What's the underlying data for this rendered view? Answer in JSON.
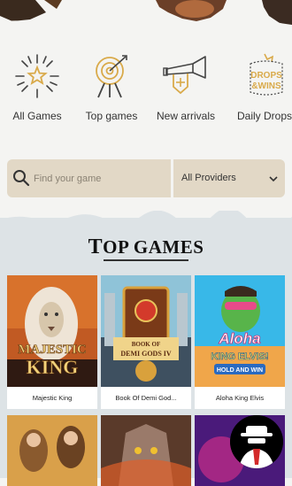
{
  "categories": [
    {
      "label": "All Games",
      "icon": "star-burst-icon"
    },
    {
      "label": "Top games",
      "icon": "archery-target-icon"
    },
    {
      "label": "New arrivals",
      "icon": "trumpet-icon"
    },
    {
      "label": "Daily Drops &",
      "icon": "drops-wins-badge-icon",
      "badge_line1": "DROPS",
      "badge_line2": "&WINS"
    }
  ],
  "search": {
    "placeholder": "Find your game"
  },
  "providers": {
    "selected": "All Providers"
  },
  "section": {
    "title_first": "T",
    "title_rest": "OP GAMES"
  },
  "games": [
    {
      "name": "Majestic King",
      "art_line1": "MAJESTIC",
      "art_line2": "KING"
    },
    {
      "name": "Book Of Demi God...",
      "art_line1": "BOOK OF",
      "art_line2": "DEMI GODS IV"
    },
    {
      "name": "Aloha King Elvis",
      "art_line1": "Aloha",
      "art_line2": "KING ELVIS!",
      "art_line3": "HOLD AND WIN"
    }
  ],
  "colors": {
    "accent": "#d9aa4a",
    "panel": "#dde3e6",
    "filter_bg": "#e2d8c6"
  }
}
